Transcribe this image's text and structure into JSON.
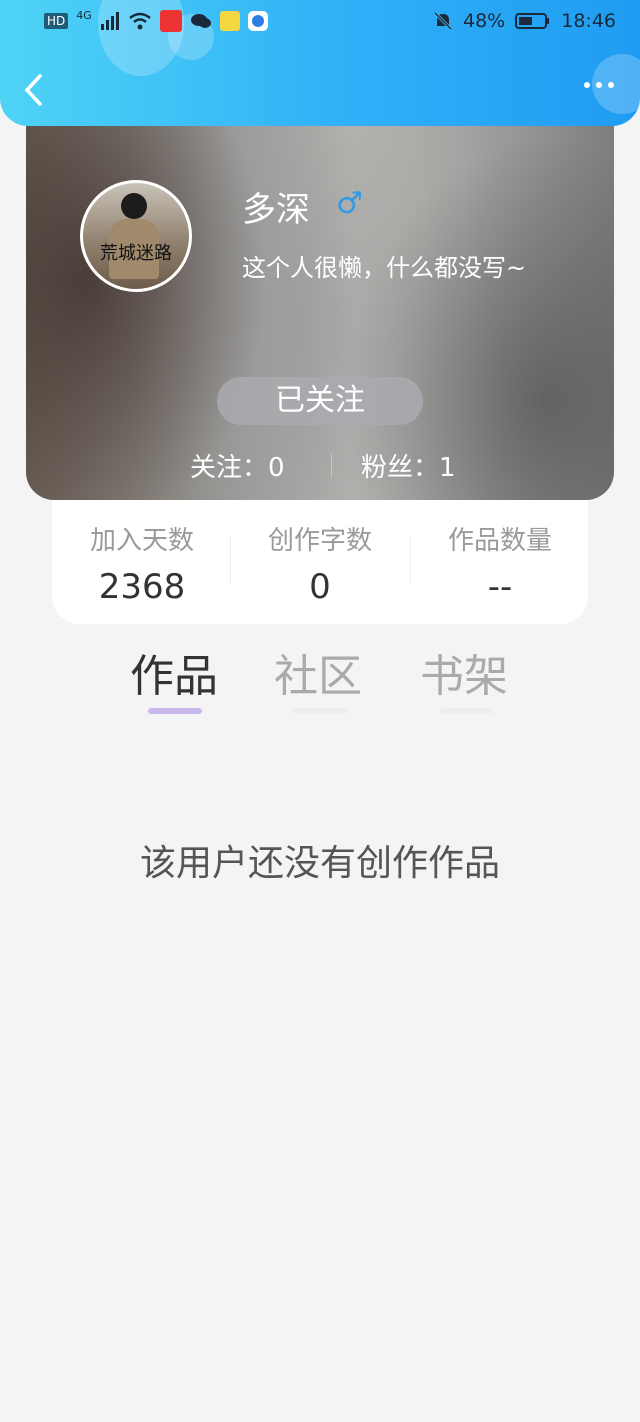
{
  "status_bar": {
    "left_icons": [
      "hd-icon",
      "4g-signal-icon",
      "wifi-icon",
      "app-icon",
      "chat-icon",
      "app-icon",
      "app-icon"
    ],
    "right": {
      "battery": "48%",
      "time": "18:46"
    },
    "signal_label": "HD",
    "network_label": "4G"
  },
  "header": {
    "back_icon": "back-chevron-icon",
    "more_icon": "more-dots-icon"
  },
  "profile": {
    "name": "多深",
    "gender_symbol": "♂",
    "bio": "这个人很懒，什么都没写~",
    "avatar_caption": "荒城迷路",
    "follow_button": "已关注",
    "following_label": "关注：0",
    "followers_label": "粉丝：1"
  },
  "stats": [
    {
      "label": "加入天数",
      "value": "2368"
    },
    {
      "label": "创作字数",
      "value": "0"
    },
    {
      "label": "作品数量",
      "value": "--"
    }
  ],
  "tabs": [
    {
      "label": "作品",
      "active": true
    },
    {
      "label": "社区",
      "active": false
    },
    {
      "label": "书架",
      "active": false
    }
  ],
  "empty_message": "该用户还没有创作作品",
  "colors": {
    "header_gradient_start": "#4fd3f5",
    "header_gradient_end": "#1f9cf2",
    "gender_blue": "#2f9be6",
    "active_indicator": "#c8b8ec"
  }
}
